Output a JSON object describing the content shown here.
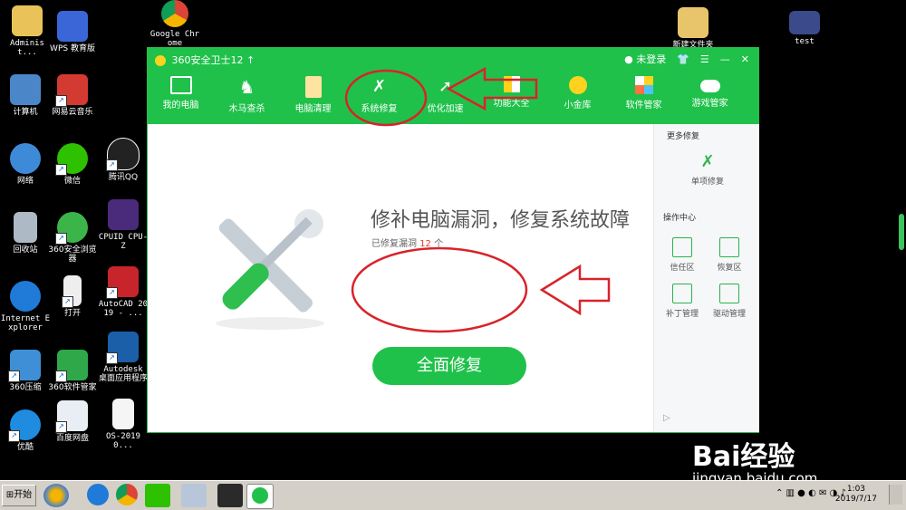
{
  "desktop": {
    "icons": [
      {
        "label": "Administ..."
      },
      {
        "label": "WPS 教育版"
      },
      {
        "label": "Google Chrome"
      },
      {
        "label": "新建文件夹"
      },
      {
        "label": "test"
      },
      {
        "label": "计算机"
      },
      {
        "label": "网易云音乐"
      },
      {
        "label": "网络"
      },
      {
        "label": "微信"
      },
      {
        "label": "腾讯QQ"
      },
      {
        "label": "回收站"
      },
      {
        "label": "360安全浏览器"
      },
      {
        "label": "CPUID CPU-Z"
      },
      {
        "label": "Internet Explorer"
      },
      {
        "label": "打开"
      },
      {
        "label": "AutoCAD 2019 - ..."
      },
      {
        "label": "360压缩"
      },
      {
        "label": "360软件管家"
      },
      {
        "label": "Autodesk 桌面应用程序"
      },
      {
        "label": "优酷"
      },
      {
        "label": "百度网盘"
      },
      {
        "label": "OS-20190..."
      }
    ]
  },
  "window": {
    "title": "360安全卫士12",
    "login": "未登录",
    "nav": [
      {
        "label": "我的电脑"
      },
      {
        "label": "木马查杀"
      },
      {
        "label": "电脑清理"
      },
      {
        "label": "系统修复"
      },
      {
        "label": "优化加速"
      },
      {
        "label": "功能大全"
      },
      {
        "label": "小金库"
      },
      {
        "label": "软件管家"
      },
      {
        "label": "游戏管家"
      }
    ],
    "main": {
      "headline": "修补电脑漏洞，修复系统故障",
      "sub_prefix": "已修复漏洞",
      "sub_count": "12",
      "sub_suffix": "个",
      "button": "全面修复"
    },
    "sidebar": {
      "more_head": "更多修复",
      "single": "单项修复",
      "ops_head": "操作中心",
      "items": [
        {
          "label": "信任区"
        },
        {
          "label": "恢复区"
        },
        {
          "label": "补丁管理"
        },
        {
          "label": "驱动管理"
        }
      ]
    }
  },
  "taskbar": {
    "start": "开始",
    "time": "1:03",
    "date": "2019/7/17"
  },
  "watermark": {
    "brand": "Bai经验",
    "url": "jingyan.baidu.com"
  },
  "colors": {
    "brand_green": "#1fc14a",
    "annotation_red": "#d8232a"
  }
}
